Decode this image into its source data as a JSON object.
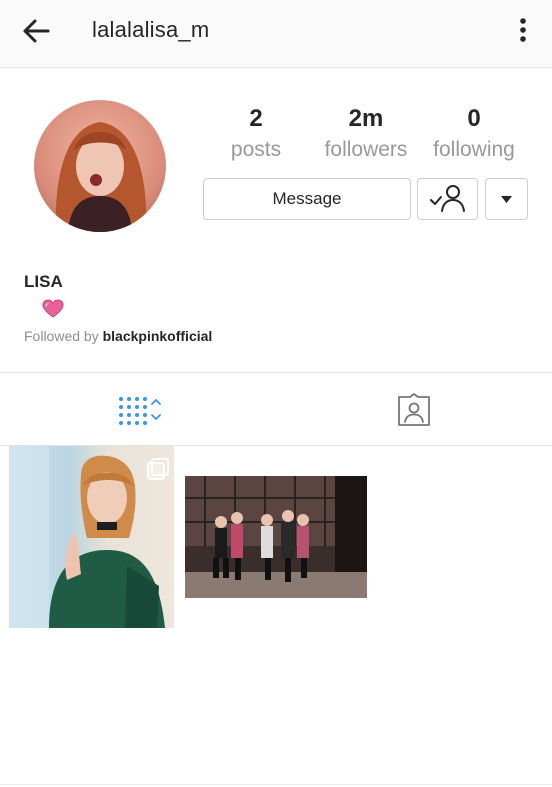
{
  "header": {
    "username": "lalalalisa_m",
    "back_icon": "arrow-left-icon",
    "menu_icon": "more-vertical-icon"
  },
  "profile": {
    "stats": [
      {
        "value": "2",
        "label": "posts"
      },
      {
        "value": "2m",
        "label": "followers"
      },
      {
        "value": "0",
        "label": "following"
      }
    ],
    "buttons": {
      "message_label": "Message",
      "following_icon": "user-check-icon",
      "dropdown_icon": "caret-down-icon"
    }
  },
  "bio": {
    "name": "LISA",
    "emoji_icon": "pink-heart-icon",
    "followed_by_prefix": "Followed by ",
    "followed_by_user": "blackpinkofficial"
  },
  "tabs": [
    {
      "icon": "grid-icon",
      "active": true
    },
    {
      "icon": "tagged-person-icon",
      "active": false
    }
  ],
  "colors": {
    "active_tab": "#3897f0",
    "muted_text": "#999999",
    "heart": "#e8619a"
  }
}
